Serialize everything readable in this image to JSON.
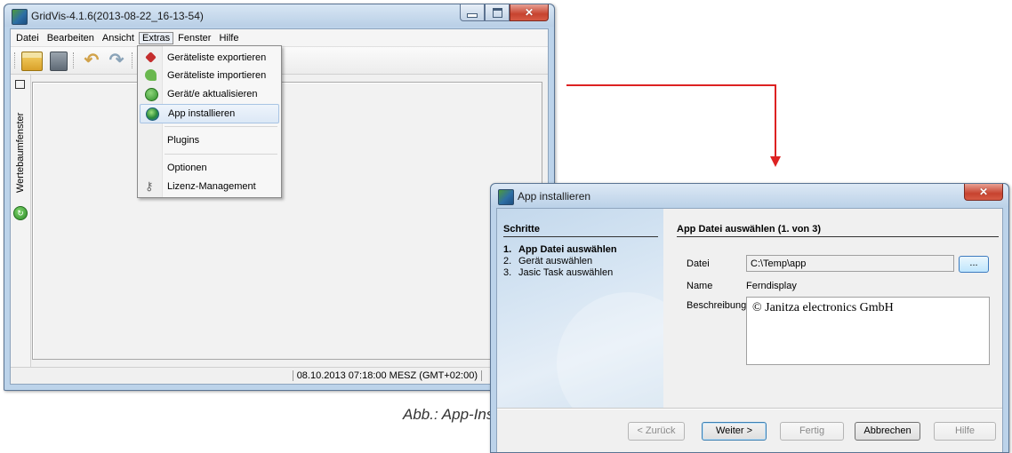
{
  "main_window": {
    "title": "GridVis-4.1.6(2013-08-22_16-13-54)",
    "menu": [
      "Datei",
      "Bearbeiten",
      "Ansicht",
      "Extras",
      "Fenster",
      "Hilfe"
    ],
    "open_menu": "Extras",
    "extras_menu": [
      {
        "label": "Geräteliste exportieren",
        "icon": "export-icon",
        "highlighted": false
      },
      {
        "label": "Geräteliste importieren",
        "icon": "import-icon",
        "highlighted": false
      },
      {
        "label": "Gerät/e aktualisieren",
        "icon": "update-icon",
        "highlighted": false
      },
      {
        "label": "App installieren",
        "icon": "globe-icon",
        "highlighted": true
      },
      {
        "label": "Plugins",
        "icon": "",
        "highlighted": false
      },
      {
        "label": "Optionen",
        "icon": "",
        "highlighted": false
      },
      {
        "label": "Lizenz-Management",
        "icon": "key-icon",
        "highlighted": false
      }
    ],
    "side_panel_label": "Wertebaumfenster",
    "status_text": "08.10.2013 07:18:00 MESZ (GMT+02:00)"
  },
  "caption": "Abb.: App-Installation",
  "dialog": {
    "title": "App installieren",
    "steps_header": "Schritte",
    "steps": [
      {
        "num": "1.",
        "label": "App Datei auswählen",
        "active": true
      },
      {
        "num": "2.",
        "label": "Gerät auswählen",
        "active": false
      },
      {
        "num": "3.",
        "label": "Jasic Task auswählen",
        "active": false
      }
    ],
    "panel_title": "App Datei auswählen (1. von 3)",
    "fields": {
      "file_label": "Datei",
      "file_value": "C:\\Temp\\app",
      "browse_label": "...",
      "name_label": "Name",
      "name_value": "Ferndisplay",
      "description_label": "Beschreibung",
      "description_value": "© Janitza electronics GmbH"
    },
    "buttons": {
      "back": "< Zurück",
      "next": "Weiter >",
      "finish": "Fertig",
      "cancel": "Abbrechen",
      "help": "Hilfe"
    }
  },
  "colors": {
    "arrow": "#dd2222",
    "window_frame": "#bcd3ea",
    "highlight": "#dce8f6"
  }
}
